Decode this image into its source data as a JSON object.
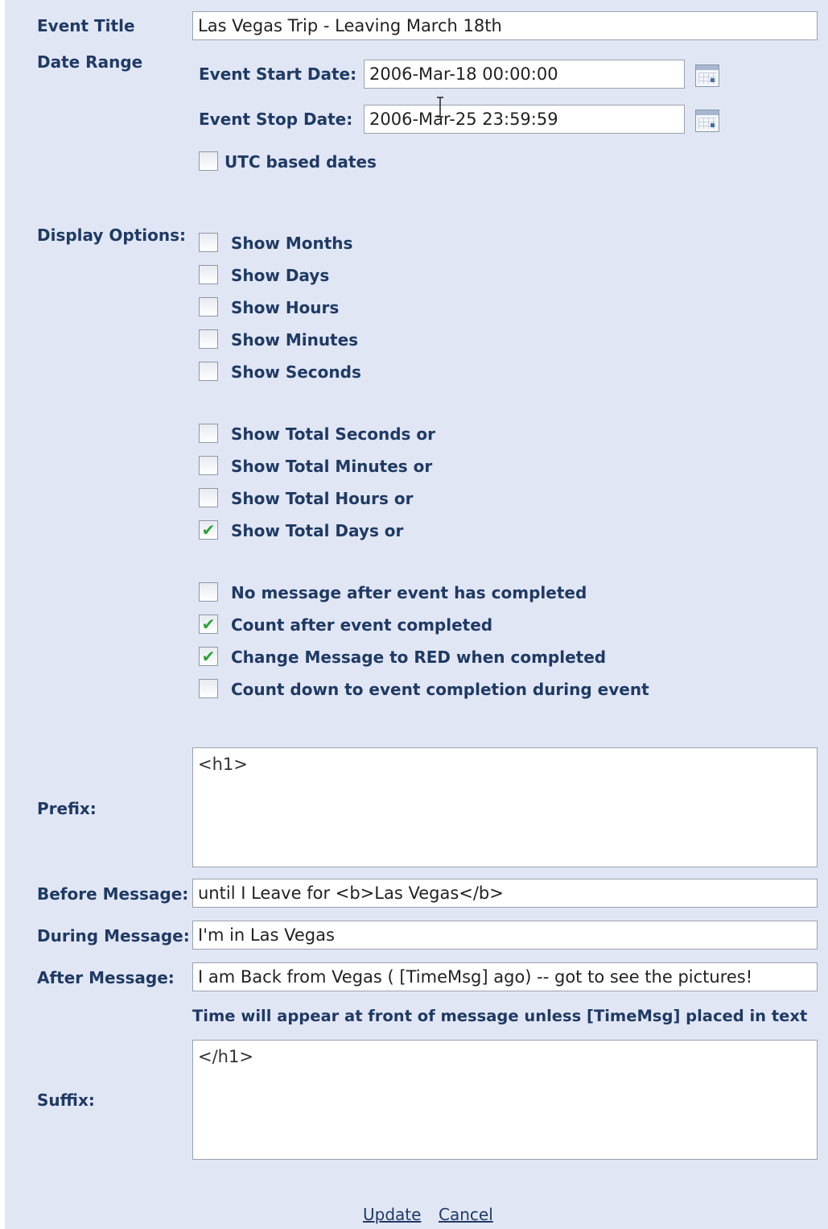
{
  "form": {
    "event_title_label": "Event Title",
    "event_title_value": "Las Vegas Trip - Leaving March 18th",
    "date_range_label": "Date Range",
    "start_label": "Event Start Date:",
    "start_value": "2006-Mar-18 00:00:00",
    "stop_label": "Event Stop Date:",
    "stop_value": "2006-Mar-25 23:59:59",
    "utc_label": "UTC based dates",
    "utc_checked": false
  },
  "display_options": {
    "label": "Display Options:",
    "group1": [
      {
        "label": "Show Months",
        "checked": false
      },
      {
        "label": "Show Days",
        "checked": false
      },
      {
        "label": "Show Hours",
        "checked": false
      },
      {
        "label": "Show Minutes",
        "checked": false
      },
      {
        "label": "Show Seconds",
        "checked": false
      }
    ],
    "group2": [
      {
        "label": "Show Total Seconds or",
        "checked": false
      },
      {
        "label": "Show Total Minutes or",
        "checked": false
      },
      {
        "label": "Show Total Hours or",
        "checked": false
      },
      {
        "label": "Show Total Days or",
        "checked": true
      }
    ],
    "group3": [
      {
        "label": "No message after event has completed",
        "checked": false
      },
      {
        "label": "Count after event completed",
        "checked": true
      },
      {
        "label": "Change Message to RED when completed",
        "checked": true
      },
      {
        "label": "Count down to event completion during event",
        "checked": false
      }
    ]
  },
  "messages": {
    "prefix_label": "Prefix:",
    "prefix_value": "<h1>",
    "before_label": "Before Message:",
    "before_value": "until I Leave for <b>Las Vegas</b>",
    "during_label": "During Message:",
    "during_value": "I'm in Las Vegas",
    "after_label": "After Message:",
    "after_value": "I am Back from Vegas ( [TimeMsg] ago) -- got to see the pictures!",
    "hint": "Time will appear at front of message unless [TimeMsg] placed in text",
    "suffix_label": "Suffix:",
    "suffix_value": "</h1>"
  },
  "actions": {
    "update": "Update",
    "cancel": "Cancel"
  },
  "icons": {
    "calendar": "calendar-icon",
    "check": "check-icon"
  }
}
